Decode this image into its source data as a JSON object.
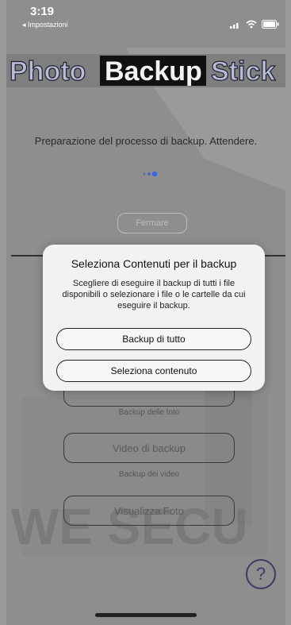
{
  "status_bar": {
    "time": "3:19",
    "back_label": "◂ Impostazioni"
  },
  "logo": {
    "word1": "Photo",
    "word2": "Backup",
    "word3": "Stick"
  },
  "main": {
    "preparing_text": "Preparazione del processo di backup. Attendere.",
    "stop_button": "Fermare",
    "photo_caption": "Backup delle foto",
    "video_button": "Video di backup",
    "video_caption": "Backup dei video",
    "view_button": "Visualizza Foto"
  },
  "watermark": "WE SECU",
  "help_label": "?",
  "dialog": {
    "title": "Seleziona Contenuti per il backup",
    "body": "Scegliere di eseguire il backup di tutti i file disponibili o selezionare i file o le cartelle da cui eseguire il backup.",
    "backup_all_button": "Backup di tutto",
    "select_content_button": "Seleziona contenuto"
  }
}
